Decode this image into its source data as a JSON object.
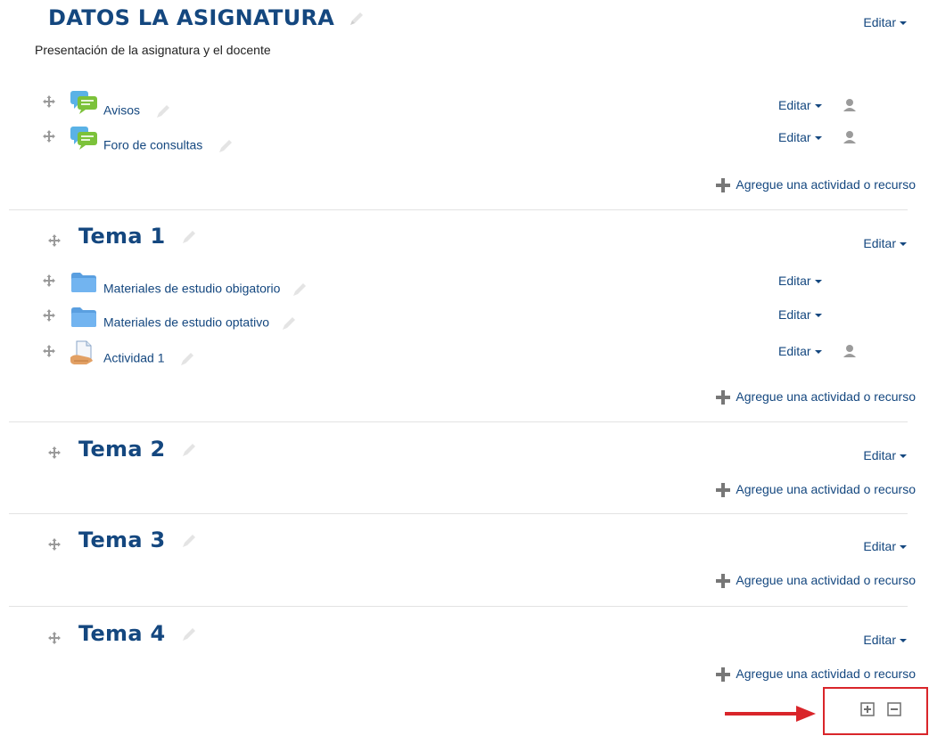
{
  "course": {
    "section0": {
      "title": "DATOS LA ASIGNATURA",
      "summary": "Presentación de la asignatura y el docente",
      "edit_label": "Editar",
      "activities": [
        {
          "name": "Avisos",
          "icon": "forum-icon",
          "edit_label": "Editar",
          "has_role_icon": true
        },
        {
          "name": "Foro de consultas",
          "icon": "forum-icon",
          "edit_label": "Editar",
          "has_role_icon": true
        }
      ],
      "add_label": "Agregue una actividad o recurso"
    },
    "sections": [
      {
        "title": "Tema 1",
        "edit_label": "Editar",
        "activities": [
          {
            "name": "Materiales de estudio obigatorio",
            "icon": "folder-icon",
            "edit_label": "Editar"
          },
          {
            "name": "Materiales de estudio optativo",
            "icon": "folder-icon",
            "edit_label": "Editar"
          },
          {
            "name": "Actividad 1",
            "icon": "assignment-icon",
            "edit_label": "Editar",
            "has_role_icon": true
          }
        ],
        "add_label": "Agregue una actividad o recurso"
      },
      {
        "title": "Tema 2",
        "edit_label": "Editar",
        "add_label": "Agregue una actividad o recurso"
      },
      {
        "title": "Tema 3",
        "edit_label": "Editar",
        "add_label": "Agregue una actividad o recurso"
      },
      {
        "title": "Tema 4",
        "edit_label": "Editar",
        "add_label": "Agregue una actividad o recurso"
      }
    ]
  },
  "footer_controls": {
    "add_section_icon": "plus-square-icon",
    "remove_section_icon": "minus-square-icon"
  },
  "colors": {
    "link": "#14477f",
    "annotation": "#d9252a"
  }
}
